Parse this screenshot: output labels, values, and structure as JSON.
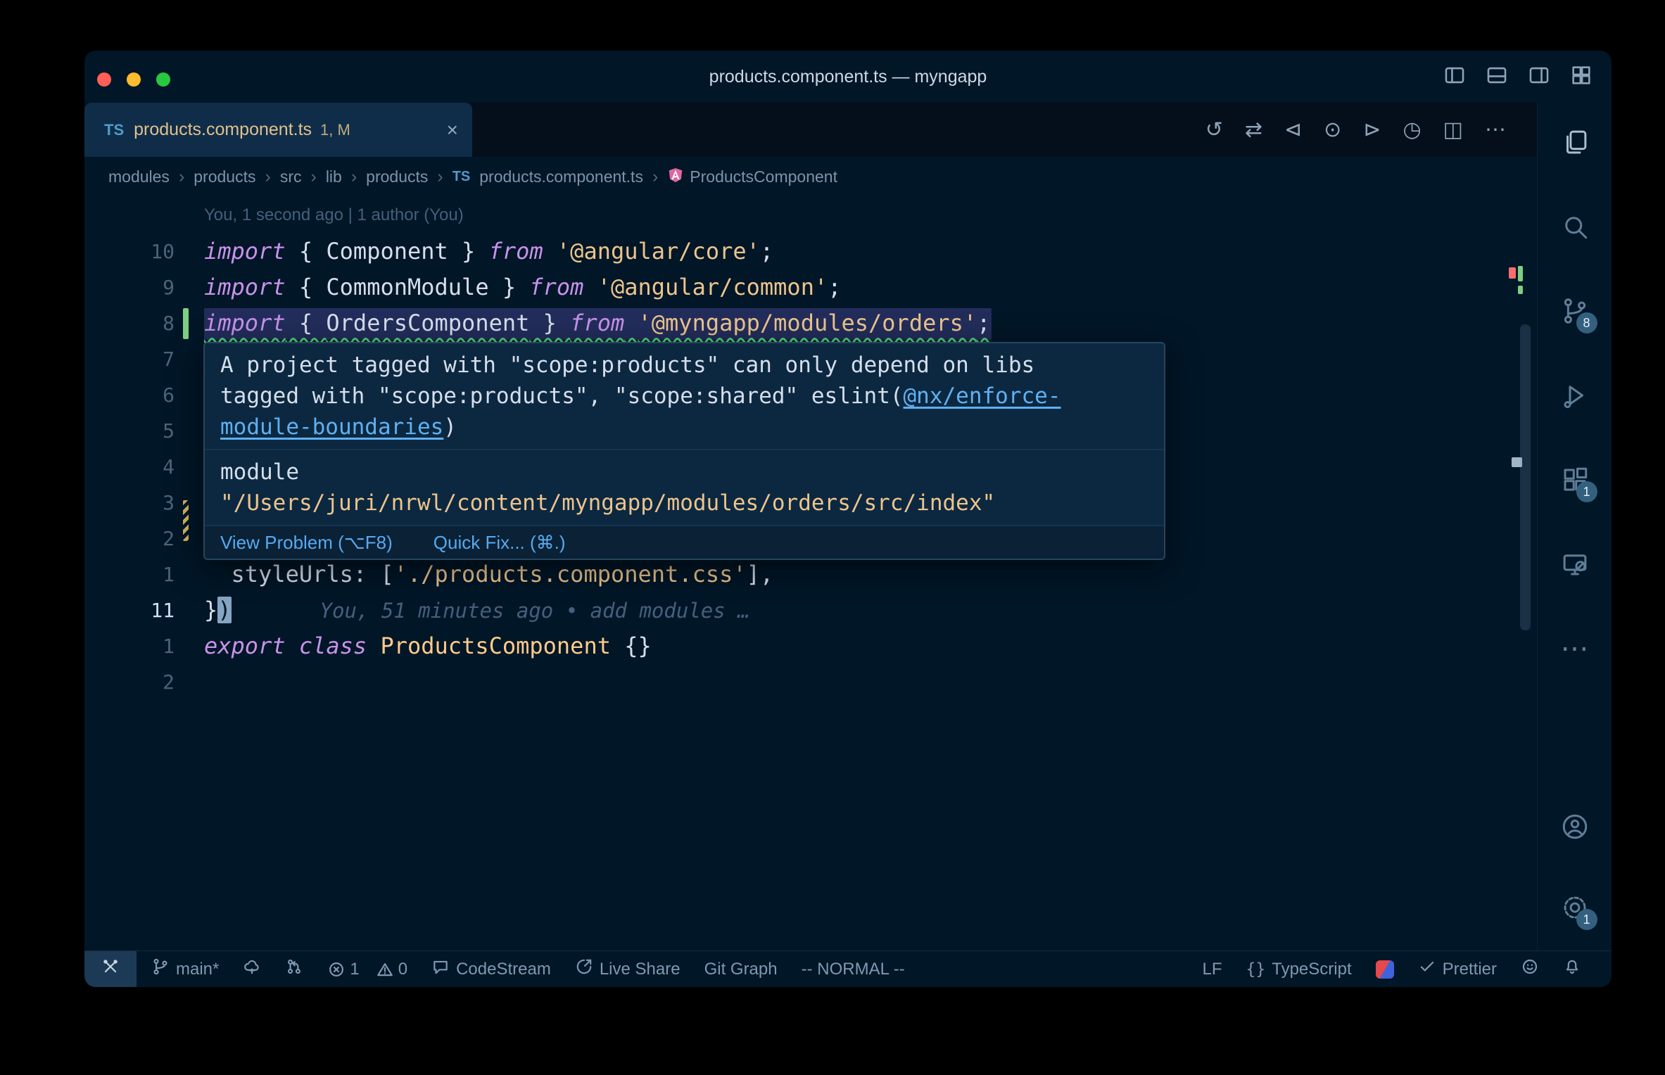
{
  "window": {
    "title": "products.component.ts — myngapp",
    "layout_icons": [
      {
        "name": "layout-sidebar-left-icon",
        "icon": "layoutL"
      },
      {
        "name": "layout-panel-icon",
        "icon": "layoutB"
      },
      {
        "name": "layout-sidebar-right-icon",
        "icon": "layoutR"
      },
      {
        "name": "layout-grid-icon",
        "icon": "layoutG"
      }
    ]
  },
  "tab": {
    "type_icon": "TS",
    "label": "products.component.ts",
    "decoration": "1, M",
    "close_glyph": "×"
  },
  "editor_actions": [
    {
      "name": "timeline-history-icon",
      "glyph": "↺"
    },
    {
      "name": "compare-changes-icon",
      "glyph": "⇄"
    },
    {
      "name": "previous-change-icon",
      "glyph": "⊲"
    },
    {
      "name": "change-indicator-icon",
      "glyph": "⊙"
    },
    {
      "name": "next-change-icon",
      "glyph": "⊳"
    },
    {
      "name": "run-timer-icon",
      "glyph": "◷"
    },
    {
      "name": "split-editor-icon",
      "glyph": "◫"
    },
    {
      "name": "more-actions-icon",
      "glyph": "⋯"
    }
  ],
  "breadcrumbs": {
    "separator": "›",
    "folders": [
      "modules",
      "products",
      "src",
      "lib",
      "products"
    ],
    "file": {
      "icon_text": "TS",
      "label": "products.component.ts"
    },
    "symbol": {
      "label": "ProductsComponent"
    }
  },
  "editor": {
    "gitlens_annotation": "You, 1 second ago | 1 author (You)",
    "inline_blame": "You, 51 minutes ago • add modules …",
    "lines": [
      {
        "num": "10",
        "tokens": [
          [
            "import",
            "kw"
          ],
          [
            " { ",
            "fg"
          ],
          [
            "Component",
            "fg"
          ],
          [
            " } ",
            "fg"
          ],
          [
            "from",
            "kw"
          ],
          [
            " ",
            "fg"
          ],
          [
            "'@angular/core'",
            "str"
          ],
          [
            ";",
            "fg"
          ]
        ]
      },
      {
        "num": "9",
        "tokens": [
          [
            "import",
            "kw"
          ],
          [
            " { ",
            "fg"
          ],
          [
            "CommonModule",
            "fg"
          ],
          [
            " } ",
            "fg"
          ],
          [
            "from",
            "kw"
          ],
          [
            " ",
            "fg"
          ],
          [
            "'@angular/common'",
            "str"
          ],
          [
            ";",
            "fg"
          ]
        ]
      },
      {
        "num": "8",
        "highlight": true,
        "gutter": "added",
        "tokens": [
          [
            "import",
            "kw"
          ],
          [
            " { ",
            "fg"
          ],
          [
            "OrdersComponent",
            "fg"
          ],
          [
            " } ",
            "fg"
          ],
          [
            "from",
            "kw"
          ],
          [
            " ",
            "fg"
          ],
          [
            "'@myngapp/modules/orders'",
            "str"
          ],
          [
            ";",
            "fg"
          ]
        ]
      },
      {
        "num": "7",
        "tokens": []
      },
      {
        "num": "6",
        "tokens": []
      },
      {
        "num": "5",
        "tokens": []
      },
      {
        "num": "4",
        "tokens": []
      },
      {
        "num": "3",
        "gutter": "modified",
        "tokens": []
      },
      {
        "num": "2",
        "tokens": []
      },
      {
        "num": "1",
        "tokens": [
          [
            "  styleUrls",
            "fg"
          ],
          [
            ": [",
            "fg"
          ],
          [
            "'./products.component.css'",
            "str"
          ],
          [
            "],",
            "fg"
          ]
        ]
      },
      {
        "num": "11",
        "current": true,
        "blame": true,
        "tokens": [
          [
            "}",
            "fg"
          ],
          [
            ")",
            "cursor"
          ]
        ]
      },
      {
        "num": "1",
        "tokens": [
          [
            "export",
            "kw"
          ],
          [
            " ",
            "fg"
          ],
          [
            "class",
            "kw"
          ],
          [
            " ",
            "fg"
          ],
          [
            "ProductsComponent",
            "cls"
          ],
          [
            " {}",
            "fg"
          ]
        ]
      },
      {
        "num": "2",
        "tokens": []
      }
    ]
  },
  "popup": {
    "message": [
      [
        [
          "A project tagged with \"scope:products\" can only depend on libs",
          "fg"
        ]
      ],
      [
        [
          "tagged with \"scope:products\", \"scope:shared\" eslint(",
          "fg"
        ],
        [
          "@nx/enforce-",
          "link"
        ]
      ],
      [
        [
          "module-boundaries",
          "link"
        ],
        [
          ")",
          "fg"
        ]
      ]
    ],
    "module": [
      [
        [
          "module",
          "fg"
        ]
      ],
      [
        [
          "\"/Users/juri/nrwl/content/myngapp/modules/orders/src/index\"",
          "str"
        ]
      ]
    ],
    "actions": [
      {
        "name": "view-problem-action",
        "label": "View Problem (⌥F8)"
      },
      {
        "name": "quick-fix-action",
        "label": "Quick Fix... (⌘.)"
      }
    ]
  },
  "activity_bar": [
    {
      "name": "explorer-icon",
      "icon": "files",
      "active": true
    },
    {
      "name": "search-icon",
      "icon": "search"
    },
    {
      "name": "source-control-icon",
      "icon": "branch",
      "badge": "8"
    },
    {
      "name": "run-debug-icon",
      "icon": "flask"
    },
    {
      "name": "extensions-icon",
      "icon": "extensions",
      "badge": "1"
    },
    {
      "name": "remote-explorer-icon",
      "icon": "monitor"
    },
    {
      "name": "more-tools-icon",
      "glyph": "⋯"
    },
    {
      "name": "account-icon",
      "icon": "person",
      "bottom": true
    },
    {
      "name": "settings-gear-icon",
      "icon": "gear",
      "badge": "1",
      "bottom": true
    }
  ],
  "status_bar": {
    "left": [
      {
        "name": "remote-indicator",
        "icon": "tools",
        "boxed": true
      },
      {
        "name": "git-branch",
        "icon": "branch",
        "label": "main*"
      },
      {
        "name": "publish-changes",
        "icon": "cloud"
      },
      {
        "name": "branch-sync",
        "icon": "branch2"
      },
      {
        "name": "problems",
        "error_count": "1",
        "warning_count": "0"
      },
      {
        "name": "codestream",
        "icon": "bubble",
        "label": "CodeStream"
      },
      {
        "name": "live-share",
        "icon": "liveshare",
        "label": "Live Share"
      },
      {
        "name": "git-graph",
        "label": "Git Graph"
      },
      {
        "name": "vim-mode",
        "label": "-- NORMAL --"
      }
    ],
    "right": [
      {
        "name": "eol-indicator",
        "label": "LF"
      },
      {
        "name": "language-mode",
        "icon_text": "{}",
        "label": "TypeScript"
      },
      {
        "name": "extension-logo",
        "logo": true
      },
      {
        "name": "prettier",
        "icon": "check",
        "label": "Prettier"
      },
      {
        "name": "feedback",
        "icon": "smiley"
      },
      {
        "name": "notifications",
        "icon": "bell"
      }
    ]
  },
  "colors": {
    "background": "#011627",
    "foreground": "#d6deeb",
    "keyword": "#c792ea",
    "string": "#ecc48d",
    "class_name": "#ffcb8b",
    "link": "#5fb0f2",
    "modified_tab": "#e2c08d",
    "added_gutter": "#7fce84",
    "squiggle": "#49d17d",
    "badge": "#33607e"
  }
}
